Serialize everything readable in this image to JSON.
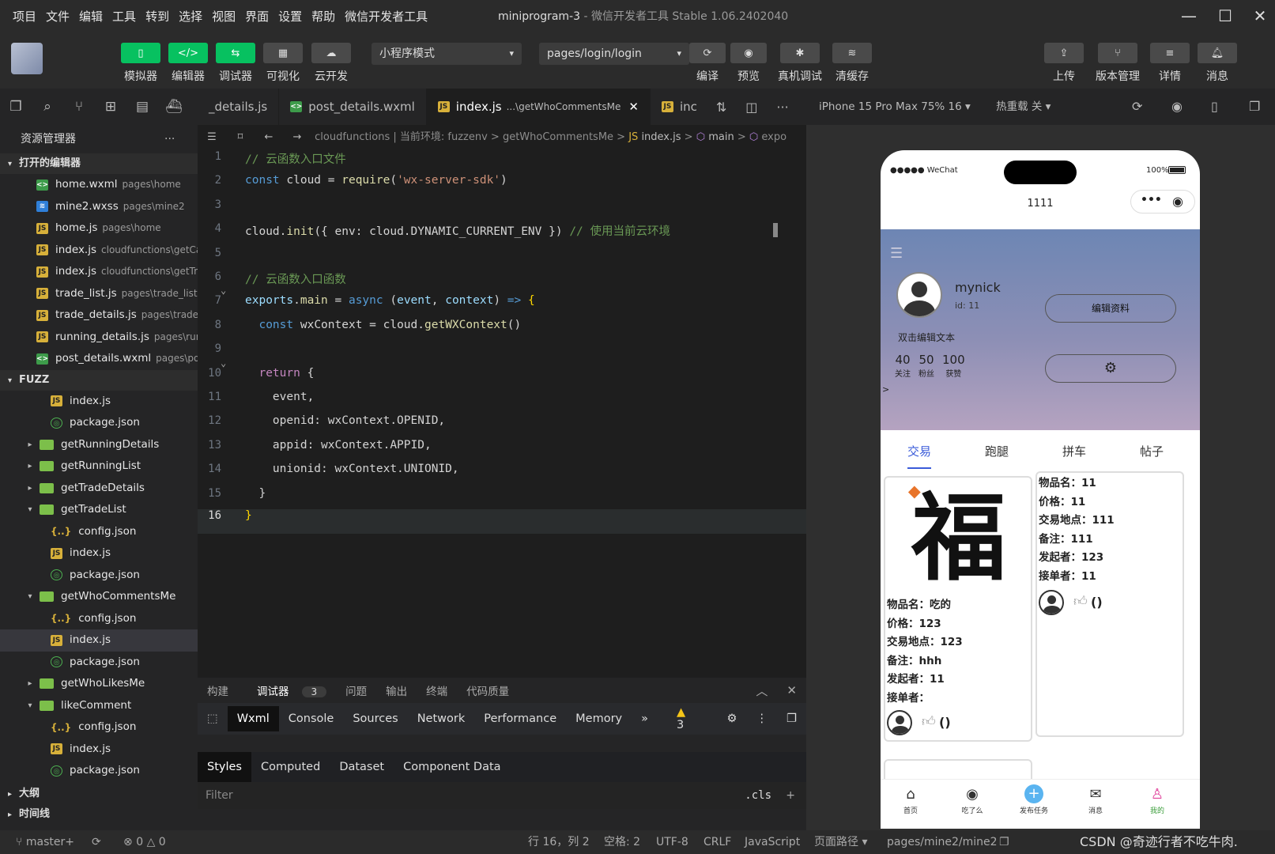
{
  "menu": [
    "项目",
    "文件",
    "编辑",
    "工具",
    "转到",
    "选择",
    "视图",
    "界面",
    "设置",
    "帮助",
    "微信开发者工具"
  ],
  "window": {
    "project": "miniprogram-3",
    "app": "微信开发者工具 Stable 1.06.2402040"
  },
  "toolbar": {
    "left": [
      {
        "label": "模拟器",
        "icon": "phone-icon"
      },
      {
        "label": "编辑器",
        "icon": "code-icon"
      },
      {
        "label": "调试器",
        "icon": "debug-icon"
      },
      {
        "label": "可视化",
        "icon": "layout-icon"
      },
      {
        "label": "云开发",
        "icon": "cloud-icon"
      }
    ],
    "mode": "小程序模式",
    "page": "pages/login/login",
    "mid": [
      {
        "label": "编译"
      },
      {
        "label": "预览"
      },
      {
        "label": "真机调试"
      },
      {
        "label": "清缓存"
      }
    ],
    "right": [
      {
        "label": "上传"
      },
      {
        "label": "版本管理"
      },
      {
        "label": "详情"
      },
      {
        "label": "消息"
      }
    ]
  },
  "explorer": {
    "title": "资源管理器",
    "open_section": "打开的编辑器",
    "open_files": [
      {
        "name": "home.wxml",
        "path": "pages\\home",
        "type": "wx"
      },
      {
        "name": "mine2.wxss",
        "path": "pages\\mine2",
        "type": "css"
      },
      {
        "name": "home.js",
        "path": "pages\\home",
        "type": "js"
      },
      {
        "name": "index.js",
        "path": "cloudfunctions\\getCa...",
        "type": "js"
      },
      {
        "name": "index.js",
        "path": "cloudfunctions\\getTr...",
        "type": "js"
      },
      {
        "name": "trade_list.js",
        "path": "pages\\trade_list",
        "type": "js"
      },
      {
        "name": "trade_details.js",
        "path": "pages\\trade_...",
        "type": "js"
      },
      {
        "name": "running_details.js",
        "path": "pages\\run...",
        "type": "js"
      },
      {
        "name": "post_details.wxml",
        "path": "pages\\po...",
        "type": "wx"
      }
    ],
    "project_section": "FUZZ",
    "tree": [
      {
        "name": "index.js",
        "type": "js",
        "indent": 2
      },
      {
        "name": "package.json",
        "type": "pk",
        "indent": 2
      },
      {
        "name": "getRunningDetails",
        "type": "fo",
        "indent": 1,
        "tri": "▸"
      },
      {
        "name": "getRunningList",
        "type": "fo",
        "indent": 1,
        "tri": "▸"
      },
      {
        "name": "getTradeDetails",
        "type": "fo",
        "indent": 1,
        "tri": "▸"
      },
      {
        "name": "getTradeList",
        "type": "fo",
        "indent": 1,
        "tri": "▾"
      },
      {
        "name": "config.json",
        "type": "cf",
        "indent": 2
      },
      {
        "name": "index.js",
        "type": "js",
        "indent": 2
      },
      {
        "name": "package.json",
        "type": "pk",
        "indent": 2
      },
      {
        "name": "getWhoCommentsMe",
        "type": "fo",
        "indent": 1,
        "tri": "▾"
      },
      {
        "name": "config.json",
        "type": "cf",
        "indent": 2
      },
      {
        "name": "index.js",
        "type": "js",
        "indent": 2,
        "sel": true
      },
      {
        "name": "package.json",
        "type": "pk",
        "indent": 2
      },
      {
        "name": "getWhoLikesMe",
        "type": "fo",
        "indent": 1,
        "tri": "▸"
      },
      {
        "name": "likeComment",
        "type": "fo",
        "indent": 1,
        "tri": "▾"
      },
      {
        "name": "config.json",
        "type": "cf",
        "indent": 2
      },
      {
        "name": "index.js",
        "type": "js",
        "indent": 2
      },
      {
        "name": "package.json",
        "type": "pk",
        "indent": 2
      }
    ],
    "outline": "大纲",
    "timeline": "时间线"
  },
  "tabs": [
    {
      "name": "_details.js"
    },
    {
      "name": "post_details.wxml",
      "type": "wx"
    },
    {
      "name": "index.js",
      "type": "js",
      "hint": "...\\getWhoCommentsMe",
      "active": true
    },
    {
      "name": "inc",
      "type": "js"
    }
  ],
  "breadcrumb": [
    "cloudfunctions | 当前环境: fuzzenv",
    "getWhoCommentsMe",
    "index.js",
    "main",
    "expo"
  ],
  "code": [
    {
      "n": "1",
      "html": "<span class='cm'>// 云函数入口文件</span>"
    },
    {
      "n": "2",
      "html": "<span class='kb'>const</span> cloud = <span class='fn'>require</span>(<span class='st'>'wx-server-sdk'</span>)"
    },
    {
      "n": "3",
      "html": ""
    },
    {
      "n": "4",
      "html": "cloud.<span class='fn'>init</span>({ env: cloud.DYNAMIC_CURRENT_ENV }) <span class='cm'>// 使用当前云环境</span>"
    },
    {
      "n": "5",
      "html": ""
    },
    {
      "n": "6",
      "html": "<span class='cm'>// 云函数入口函数</span>"
    },
    {
      "n": "7",
      "html": "<span class='vr'>exports</span>.<span class='fn'>main</span> = <span class='kb'>async</span> (<span class='vr'>event</span>, <span class='vr'>context</span>) <span class='kb'>=></span> <span class='pn'>{</span>"
    },
    {
      "n": "8",
      "html": "  <span class='kb'>const</span> wxContext = cloud.<span class='fn'>getWXContext</span>()"
    },
    {
      "n": "9",
      "html": ""
    },
    {
      "n": "10",
      "html": "  <span class='kw'>return</span> {"
    },
    {
      "n": "11",
      "html": "    event,"
    },
    {
      "n": "12",
      "html": "    openid: wxContext.OPENID,"
    },
    {
      "n": "13",
      "html": "    appid: wxContext.APPID,"
    },
    {
      "n": "14",
      "html": "    unionid: wxContext.UNIONID,"
    },
    {
      "n": "15",
      "html": "  }"
    },
    {
      "n": "16",
      "html": "<span class='pn'>}</span>"
    }
  ],
  "bottom": {
    "tabs": [
      "构建",
      "调试器",
      "问题",
      "输出",
      "终端",
      "代码质量"
    ],
    "debug_badge": "3",
    "devtools": [
      "Wxml",
      "Console",
      "Sources",
      "Network",
      "Performance",
      "Memory"
    ],
    "warn": "3",
    "style_tabs": [
      "Styles",
      "Computed",
      "Dataset",
      "Component Data"
    ],
    "filter": "Filter",
    "cls": ".cls"
  },
  "status": {
    "branch": "master+",
    "errors": "0",
    "warnings": "0",
    "pos": "行 16，列 2",
    "spaces": "空格: 2",
    "enc": "UTF-8",
    "eol": "CRLF",
    "lang": "JavaScript",
    "page_label": "页面路径",
    "page": "pages/mine2/mine2",
    "watermark": "CSDN @奇迹行者不吃牛肉."
  },
  "sim": {
    "device": "iPhone 15 Pro Max 75% 16",
    "hot": "热重载 关",
    "carrier": "●●●●● WeChat",
    "battery": "100%",
    "navtitle": "1111",
    "nick": "mynick",
    "uid": "id: 11",
    "edit": "编辑资料",
    "sign": "双击编辑文本",
    "stats": [
      {
        "n": "40",
        "l": "关注"
      },
      {
        "n": "50",
        "l": "粉丝"
      },
      {
        "n": "100",
        "l": "获赞"
      }
    ],
    "arrow": ">",
    "ptabs": [
      "交易",
      "跑腿",
      "拼车",
      "帖子"
    ],
    "card1": [
      "物品名：吃的",
      "价格：123",
      "交易地点：123",
      "备注：hhh",
      "发起者：11",
      "接单者："
    ],
    "card2": [
      "物品名：11",
      "价格：11",
      "交易地点：111",
      "备注：111",
      "发起者：123",
      "接单者：11"
    ],
    "paren": "()",
    "fu": "福",
    "tabbar": [
      {
        "l": "首页",
        "i": "⌂"
      },
      {
        "l": "吃了么",
        "i": "◉"
      },
      {
        "l": "发布任务",
        "i": "+"
      },
      {
        "l": "消息",
        "i": "✉"
      },
      {
        "l": "我的",
        "i": "♙"
      }
    ]
  }
}
